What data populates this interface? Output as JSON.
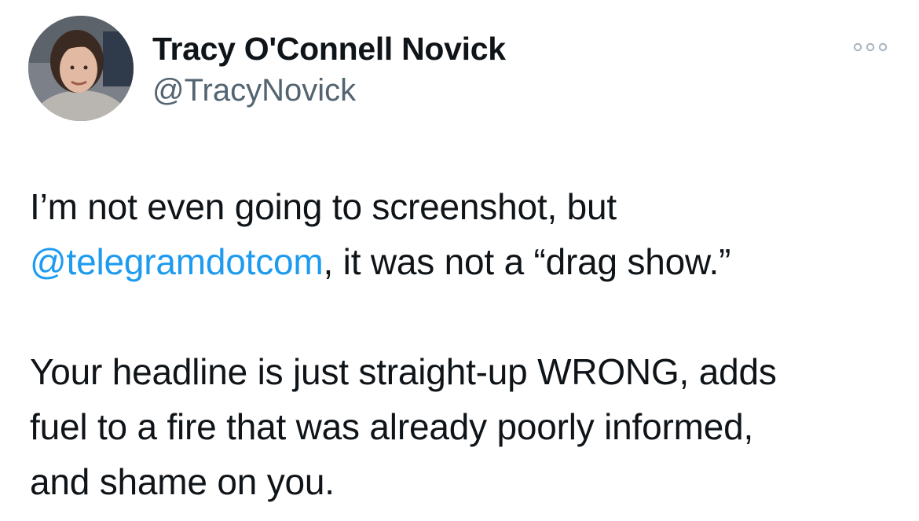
{
  "author": {
    "name": "Tracy O'Connell Novick",
    "handle": "@TracyNovick"
  },
  "more_icon": "more-horizontal-icon",
  "tweet": {
    "para1_line1": "I’m not even going to screenshot, but",
    "mention": "@telegramdotcom",
    "para1_line2_rest": ", it was not a “drag show.”",
    "para2_line1": "Your headline is just straight-up WRONG, adds",
    "para2_line2": "fuel to a fire that was already poorly informed,",
    "para2_line3": "and shame on you."
  },
  "colors": {
    "text": "#0f1419",
    "secondary": "#536471",
    "link": "#1d9bf0",
    "background": "#ffffff"
  }
}
